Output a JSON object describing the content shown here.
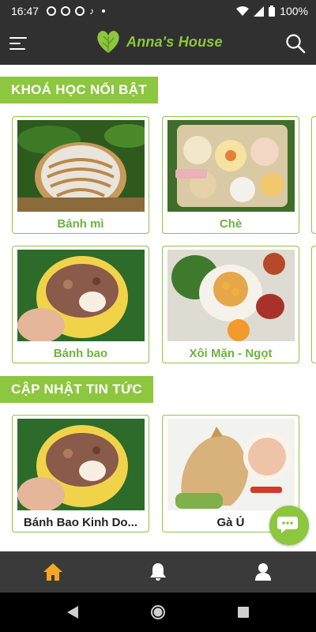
{
  "status_bar": {
    "time": "16:47",
    "battery": "100%"
  },
  "header": {
    "brand": "Anna's House",
    "menu_icon": "hamburger-menu-icon",
    "search_icon": "search-icon"
  },
  "sections": [
    {
      "title": "KHOÁ HỌC NỔI BẬT",
      "cards": [
        {
          "label": "Bánh mì",
          "image": "bread-photo"
        },
        {
          "label": "Chè",
          "image": "sweet-soup-photo"
        },
        {
          "label": "Bánh bao",
          "image": "steamed-bun-photo"
        },
        {
          "label": "Xôi Mặn - Ngọt",
          "image": "sticky-rice-photo"
        }
      ]
    },
    {
      "title": "CẬP NHẬT TIN TỨC",
      "cards": [
        {
          "label": "Bánh Bao Kinh Do...",
          "image": "steamed-bun-photo"
        },
        {
          "label": "Gà Ủ",
          "image": "chicken-photo"
        }
      ]
    }
  ],
  "bottom_nav": [
    {
      "name": "home",
      "icon": "home-icon",
      "active": true
    },
    {
      "name": "notifications",
      "icon": "bell-icon",
      "active": false
    },
    {
      "name": "profile",
      "icon": "user-icon",
      "active": false
    }
  ],
  "colors": {
    "accent": "#8dc63f",
    "header_bg": "#303030",
    "nav_bg": "#3a3a3a",
    "nav_active": "#f5a623"
  }
}
